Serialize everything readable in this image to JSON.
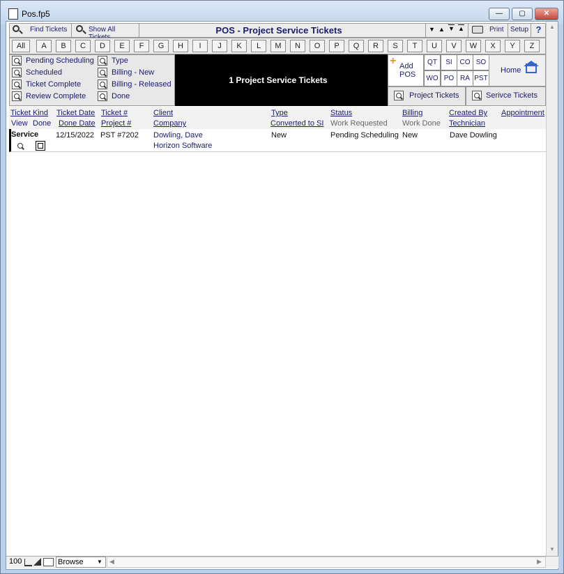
{
  "window": {
    "title": "Pos.fp5",
    "min_label": "—",
    "max_label": "▢",
    "close_label": "✕"
  },
  "toolbar": {
    "find_tickets": "Find Tickets",
    "show_all_tickets": "Show All Tickets",
    "header_title": "POS - Project Service Tickets",
    "print_label": "Print",
    "setup_label": "Setup",
    "help_label": "?"
  },
  "alphabet": [
    "All",
    "A",
    "B",
    "C",
    "D",
    "E",
    "F",
    "G",
    "H",
    "I",
    "J",
    "K",
    "L",
    "M",
    "N",
    "O",
    "P",
    "Q",
    "R",
    "S",
    "T",
    "U",
    "V",
    "W",
    "X",
    "Y",
    "Z"
  ],
  "filters": {
    "left": [
      "Pending Scheduling",
      "Scheduled",
      "Ticket Complete",
      "Review Complete"
    ],
    "right": [
      "Type",
      "Billing - New",
      "Billing - Released",
      "Done"
    ]
  },
  "banner": {
    "count_text": "1 Project Service Tickets"
  },
  "add_pos": {
    "line1": "Add",
    "line2": "POS"
  },
  "codes": [
    "QT",
    "SI",
    "CO",
    "SO",
    "WO",
    "PO",
    "RA",
    "PST"
  ],
  "home_label": "Home",
  "project_tickets_label": "Project Tickets",
  "service_tickets_label": "Serivce Tickets",
  "columns": {
    "ticket_kind": "Ticket Kind",
    "view": "View",
    "done": "Done",
    "ticket_date": "Ticket Date",
    "done_date": "Done Date",
    "ticket_no": "Ticket #",
    "project_no": "Project #",
    "client": "Client",
    "company": "Company",
    "type": "Type",
    "converted": "Converted to SI",
    "status": "Status",
    "work_requested": "Work Requested",
    "billing": "Billing",
    "work_done": "Work Done",
    "created_by": "Created By",
    "technician": "Technician",
    "appointment": "Appointment"
  },
  "rows": [
    {
      "kind": "Service",
      "ticket_date": "12/15/2022",
      "ticket_no": "PST #7202",
      "client": "Dowling, Dave",
      "company": "Horizon Software",
      "type": "New",
      "status": "Pending Scheduling",
      "billing": "New",
      "created_by": "Dave Dowling"
    }
  ],
  "statusbar": {
    "zoom": "100",
    "mode": "Browse"
  }
}
